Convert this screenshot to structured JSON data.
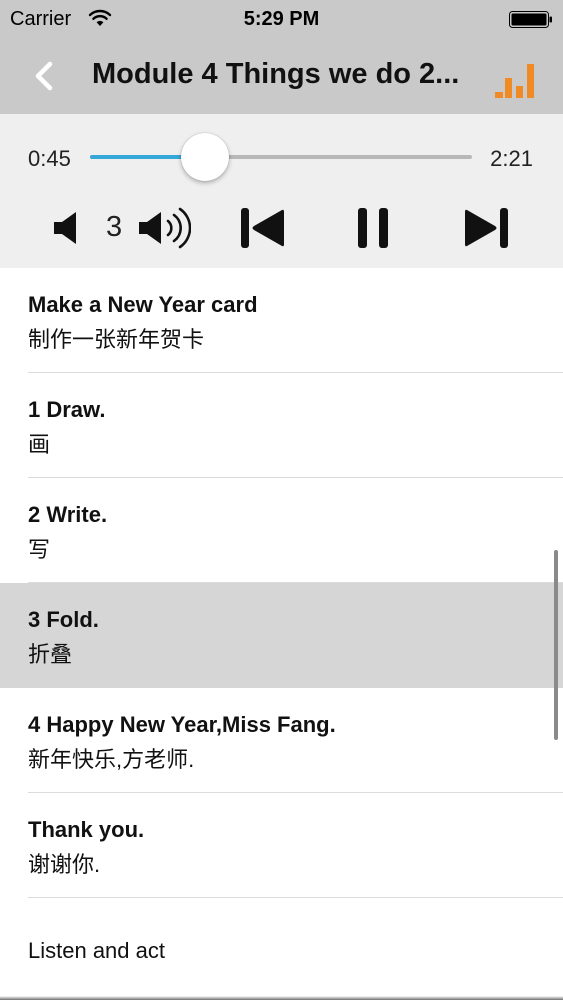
{
  "status_bar": {
    "carrier": "Carrier",
    "time": "5:29 PM",
    "wifi_icon": "wifi-icon",
    "battery_icon": "battery-icon"
  },
  "nav": {
    "back_icon": "chevron-left-icon",
    "title": "Module 4 Things we do 2...",
    "equalizer_icon": "equalizer-icon"
  },
  "player": {
    "current_time": "0:45",
    "total_time": "2:21",
    "progress": 0.3,
    "volume": "3",
    "volume_down_icon": "speaker-low-icon",
    "volume_up_icon": "speaker-high-icon",
    "prev_icon": "skip-previous-icon",
    "pause_icon": "pause-icon",
    "next_icon": "skip-next-icon"
  },
  "colors": {
    "accent": "#35a7d9",
    "equalizer": "#f08a24",
    "nav_bg": "#c9c9c9",
    "player_bg": "#efefef",
    "selected_row": "#d6d6d6"
  },
  "list": {
    "items": [
      {
        "en": "Make a New Year card",
        "cn": "制作一张新年贺卡"
      },
      {
        "en": "1 Draw.",
        "cn": "画"
      },
      {
        "en": "2 Write.",
        "cn": "写"
      },
      {
        "en": "3 Fold.",
        "cn": "折叠",
        "selected": true
      },
      {
        "en": "4 Happy New Year,Miss Fang.",
        "cn": "新年快乐,方老师."
      },
      {
        "en": "Thank you.",
        "cn": "谢谢你."
      },
      {
        "en": "Listen and act"
      }
    ]
  }
}
